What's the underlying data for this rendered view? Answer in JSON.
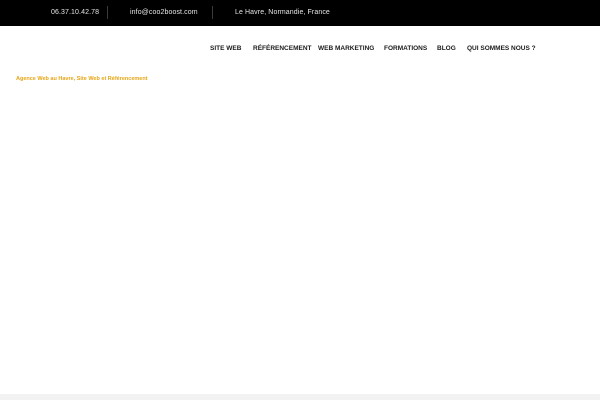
{
  "topbar": {
    "phone": "06.37.10.42.78",
    "email": "info@coo2boost.com",
    "location": "Le Havre, Normandie, France"
  },
  "nav": {
    "items": [
      {
        "label": "SITE WEB"
      },
      {
        "label": "RÉFÉRENCEMENT"
      },
      {
        "label": "WEB MARKETING"
      },
      {
        "label": "FORMATIONS"
      },
      {
        "label": "BLOG"
      },
      {
        "label": "QUI SOMMES NOUS ?"
      }
    ]
  },
  "main": {
    "tagline": "Agence Web au Havre, Site Web et Référencement"
  },
  "colors": {
    "topbar_bg": "#000000",
    "accent": "#e6a514",
    "nav_text": "#1a1a1a"
  }
}
